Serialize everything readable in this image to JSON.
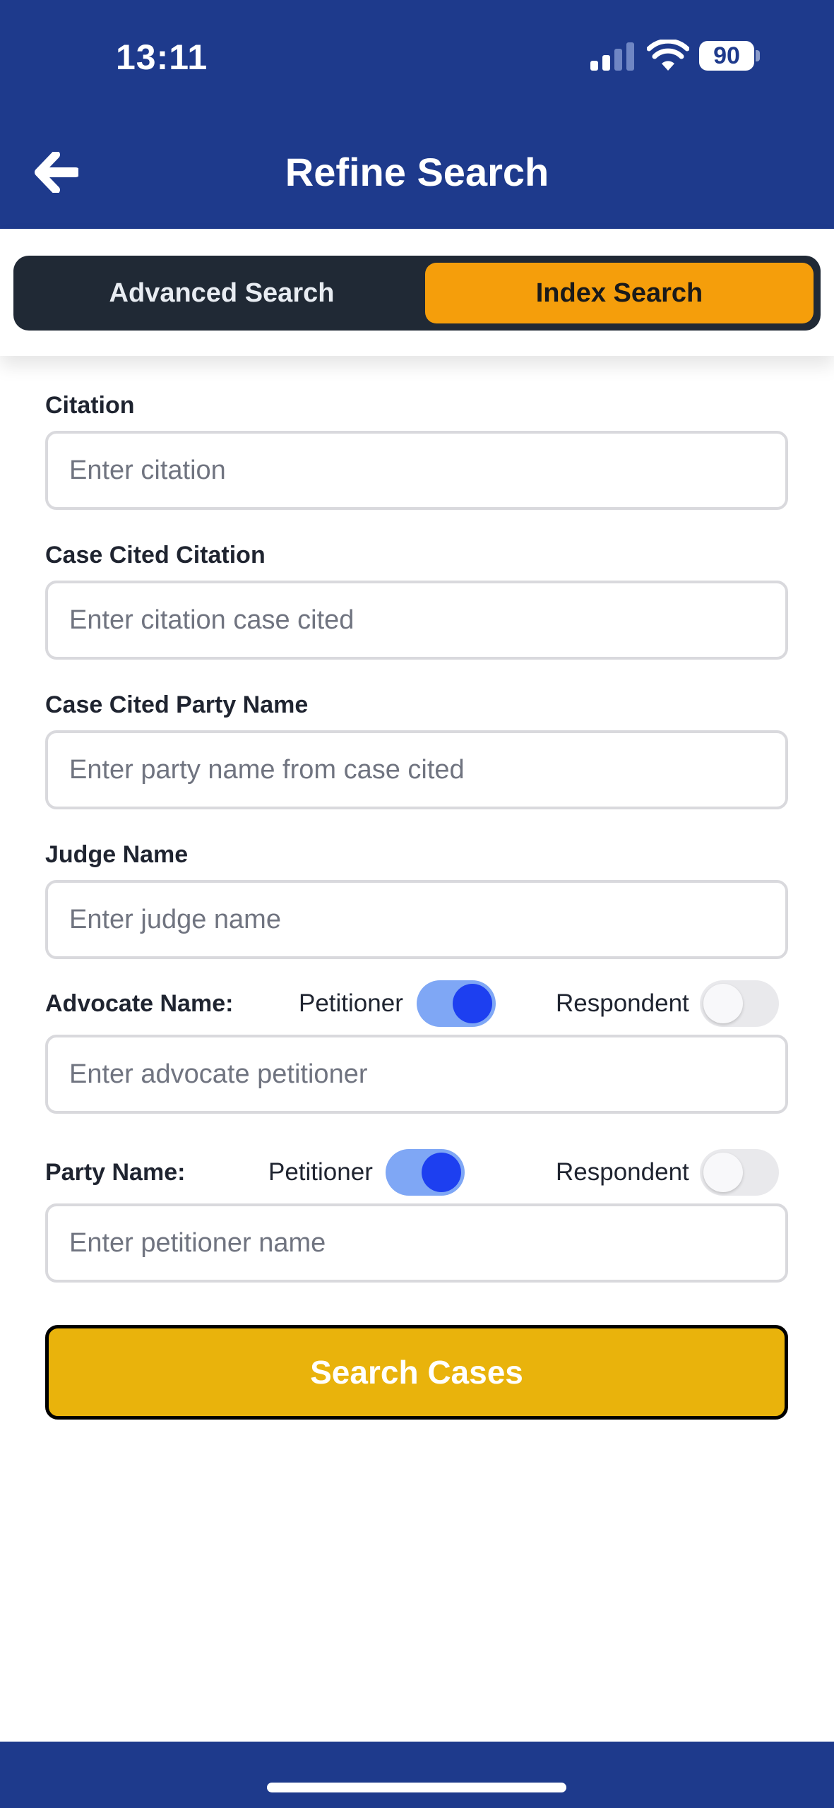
{
  "status_bar": {
    "time": "13:11",
    "battery_level": "90"
  },
  "header": {
    "back_icon": "arrow-left-icon",
    "title": "Refine Search"
  },
  "tabs": {
    "advanced": "Advanced Search",
    "index": "Index Search",
    "active_tab": "Index Search"
  },
  "form": {
    "citation": {
      "label": "Citation",
      "placeholder": "Enter citation",
      "value": ""
    },
    "case_cited_citation": {
      "label": "Case Cited Citation",
      "placeholder": "Enter citation case cited",
      "value": ""
    },
    "case_cited_party_name": {
      "label": "Case Cited Party Name",
      "placeholder": "Enter party name from case cited",
      "value": ""
    },
    "judge_name": {
      "label": "Judge Name",
      "placeholder": "Enter judge name",
      "value": ""
    },
    "advocate": {
      "label": "Advocate Name:",
      "petitioner_label": "Petitioner",
      "respondent_label": "Respondent",
      "petitioner_on": true,
      "respondent_on": false,
      "placeholder": "Enter advocate petitioner",
      "value": ""
    },
    "party": {
      "label": "Party Name:",
      "petitioner_label": "Petitioner",
      "respondent_label": "Respondent",
      "petitioner_on": true,
      "respondent_on": false,
      "placeholder": "Enter petitioner name",
      "value": ""
    },
    "submit_label": "Search Cases"
  },
  "colors": {
    "header_bg": "#1e3a8c",
    "active_tab": "#f59e0b",
    "segment_bg": "#202935",
    "toggle_on_track": "#7fa7f5",
    "toggle_on_knob": "#1d3ff0",
    "submit_bg": "#e9b30c"
  }
}
